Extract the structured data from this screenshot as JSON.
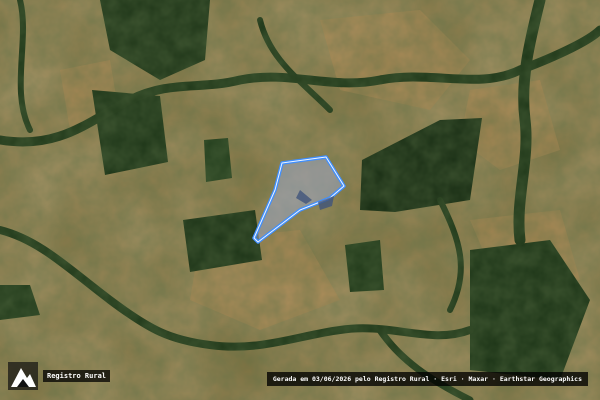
{
  "map": {
    "property_outline_color": "#3f8fff",
    "property_fill_color": "#9aa6c4",
    "imagery_palette": {
      "savanna": "#8d7a45",
      "dry_field": "#b28a52",
      "forest_dark": "#1f3518",
      "forest_medium": "#2f4a24",
      "riparian": "#243d1c"
    }
  },
  "logo": {
    "label": "Registro Rural",
    "icon": "mountain-logo-icon"
  },
  "attribution": {
    "text": "Gerada em 03/06/2026 pelo Registro Rural · Esri · Maxar · Earthstar Geographics"
  }
}
